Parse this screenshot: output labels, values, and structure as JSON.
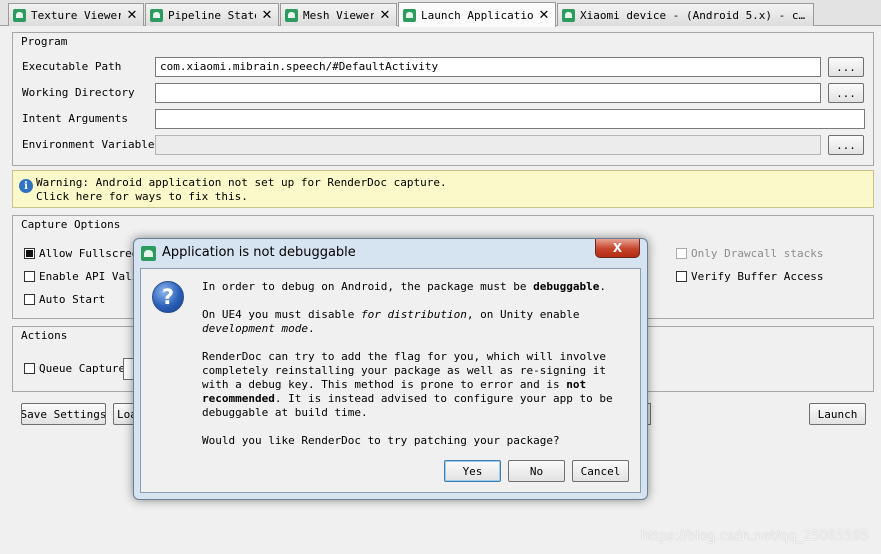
{
  "tabs": [
    {
      "label": "Texture Viewer",
      "close": "✕"
    },
    {
      "label": "Pipeline State",
      "close": "✕"
    },
    {
      "label": "Mesh Viewer",
      "close": "✕"
    },
    {
      "label": "Launch Application",
      "close": "✕"
    },
    {
      "label": "Xiaomi device - (Android 5.x) - c…",
      "close": "✕"
    }
  ],
  "program": {
    "title": "Program",
    "executable_label": "Executable Path",
    "executable_value": "com.xiaomi.mibrain.speech/#DefaultActivity",
    "working_dir_label": "Working Directory",
    "working_dir_value": "",
    "intent_label": "Intent Arguments",
    "intent_value": "",
    "env_label": "Environment Variables",
    "env_value": "",
    "browse_label": "..."
  },
  "warning": {
    "line1": "Warning: Android application not set up for RenderDoc capture.",
    "line2": "Click here for ways to fix this."
  },
  "capture_options": {
    "title": "Capture Options",
    "allow_fullscreen": "Allow Fullscreen",
    "enable_api_validation": "Enable API Validation",
    "auto_start": "Auto Start",
    "only_drawcall_stacks": "Only Drawcall stacks",
    "verify_buffer_access": "Verify Buffer Access"
  },
  "actions": {
    "title": "Actions",
    "queue_capture": "Queue Capture"
  },
  "bottom": {
    "save_settings": "Save Settings",
    "load_settings": "Load Settings",
    "launch": "Launch"
  },
  "dialog": {
    "title": "Application is not debuggable",
    "close": "X",
    "p1_a": "In order to debug on Android, the package must be ",
    "p1_b": "debuggable",
    "p1_c": ".",
    "p2_a": "On UE4 you must disable ",
    "p2_b": "for distribution",
    "p2_c": ", on Unity enable ",
    "p2_d": "development mode",
    "p2_e": ".",
    "p3_a": "RenderDoc can try to add the flag for you, which will involve completely reinstalling your package as well as re-signing it with a debug key. This method is prone to error and is ",
    "p3_b": "not recommended",
    "p3_c": ". It is instead advised to configure your app to be debuggable at build time.",
    "p4": "Would you like RenderDoc to try patching your package?",
    "yes": "Yes",
    "no": "No",
    "cancel": "Cancel"
  },
  "watermark": "https://blog.csdn.net/qq_25065595"
}
